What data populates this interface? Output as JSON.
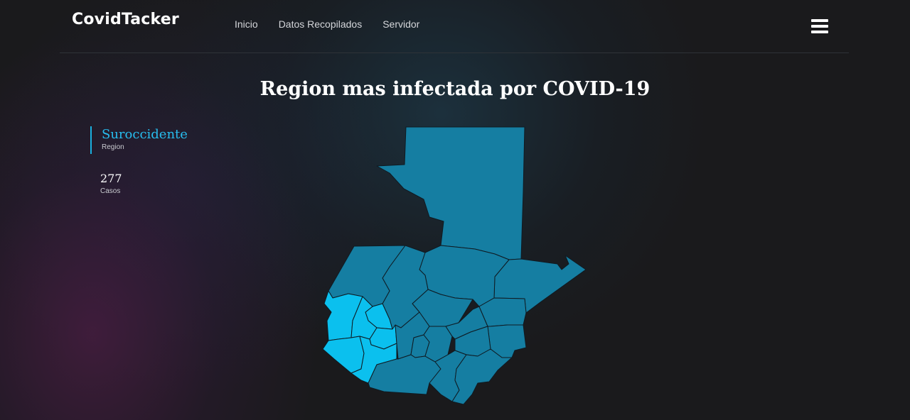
{
  "header": {
    "brand": "CovidTacker",
    "nav": [
      "Inicio",
      "Datos Recopilados",
      "Servidor"
    ],
    "menu_icon": "hamburger-menu-icon"
  },
  "main": {
    "title": "Region mas infectada por COVID-19",
    "stats": {
      "region_value": "Suroccidente",
      "region_label": "Region",
      "cases_value": "277",
      "cases_label": "Casos"
    }
  },
  "map": {
    "country": "Guatemala",
    "highlighted_region": "Suroccidente",
    "colors": {
      "default_fill": "#157ea2",
      "highlight_fill": "#0bc0ee",
      "border": "#0f1a22",
      "accent": "#27bdee"
    }
  }
}
